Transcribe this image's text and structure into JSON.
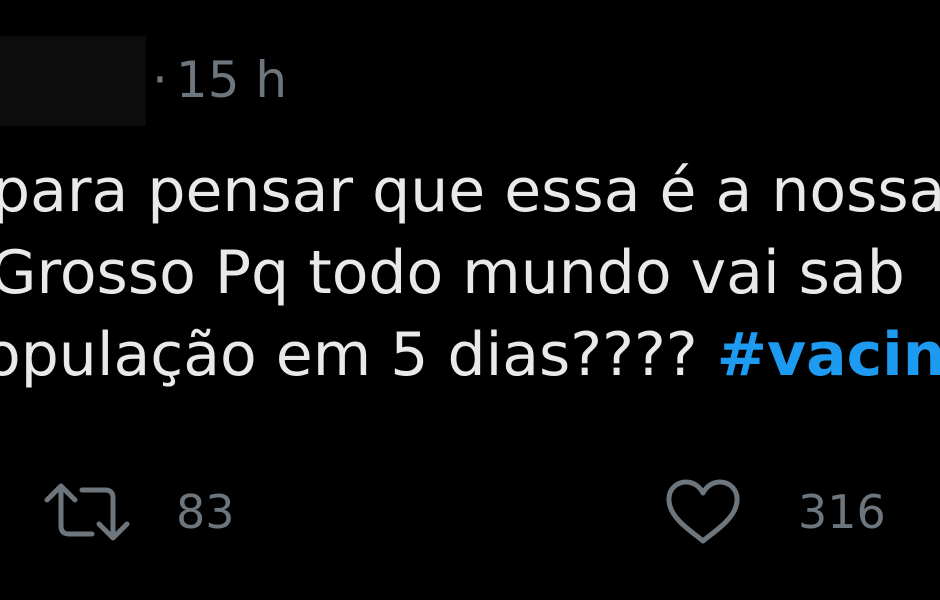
{
  "tweet": {
    "separator": "·",
    "time": "15 h",
    "lines": [
      "para pensar que essa é a nossa",
      "Grosso Pq todo mundo vai sab",
      "opulação em 5 dias????"
    ],
    "hashtag": "#vacin",
    "colors": {
      "background": "#000000",
      "text": "#e7e9ea",
      "muted": "#6e767d",
      "link": "#1d9bf0"
    }
  },
  "actions": {
    "retweet": {
      "icon": "retweet-icon",
      "count": "83"
    },
    "like": {
      "icon": "heart-icon",
      "count": "316"
    }
  }
}
